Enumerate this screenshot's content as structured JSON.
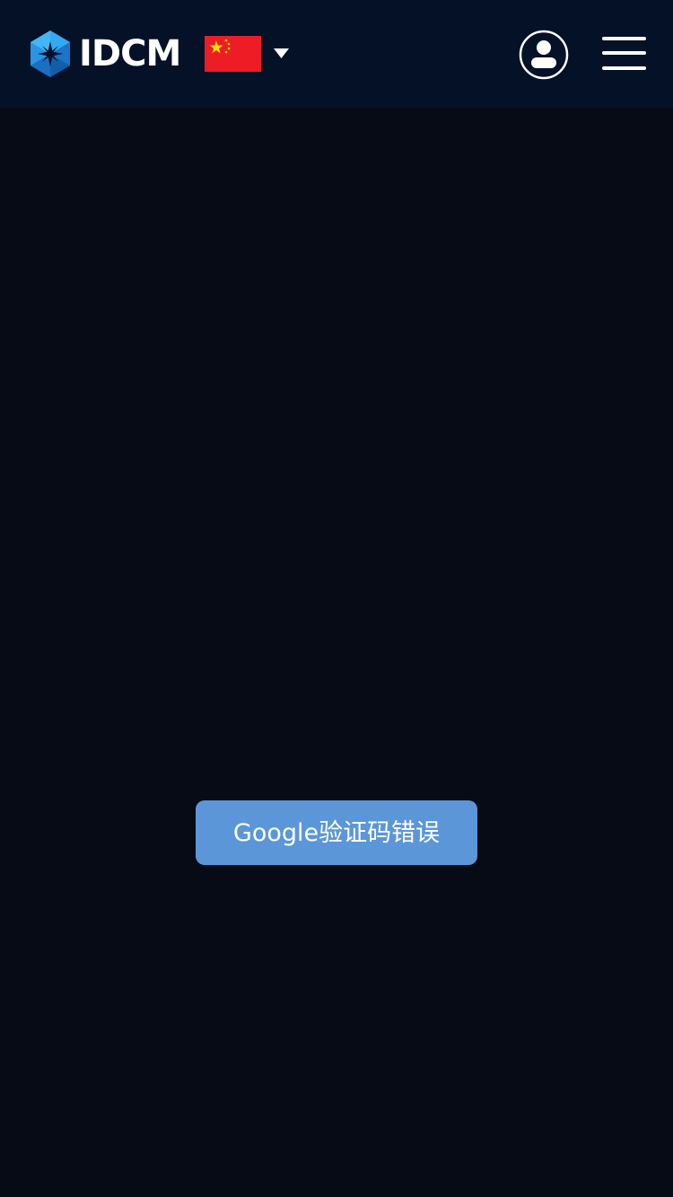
{
  "header": {
    "brand": {
      "name": "IDCM",
      "logo_icon": "idcm-hexagon-logo",
      "logo_colors": [
        "#1f9bea",
        "#1a70c4",
        "#0d4a93"
      ]
    },
    "language": {
      "selected": "zh-CN",
      "flag_icon": "china-flag-icon",
      "dropdown_icon": "caret-down-icon"
    },
    "user_icon": "user-circle-icon",
    "menu_icon": "hamburger-menu-icon",
    "background": "#041127"
  },
  "main": {
    "background": "#060b15"
  },
  "toast": {
    "message": "Google验证码错误",
    "background": "#5b97d8",
    "text_color": "#ffffff"
  }
}
